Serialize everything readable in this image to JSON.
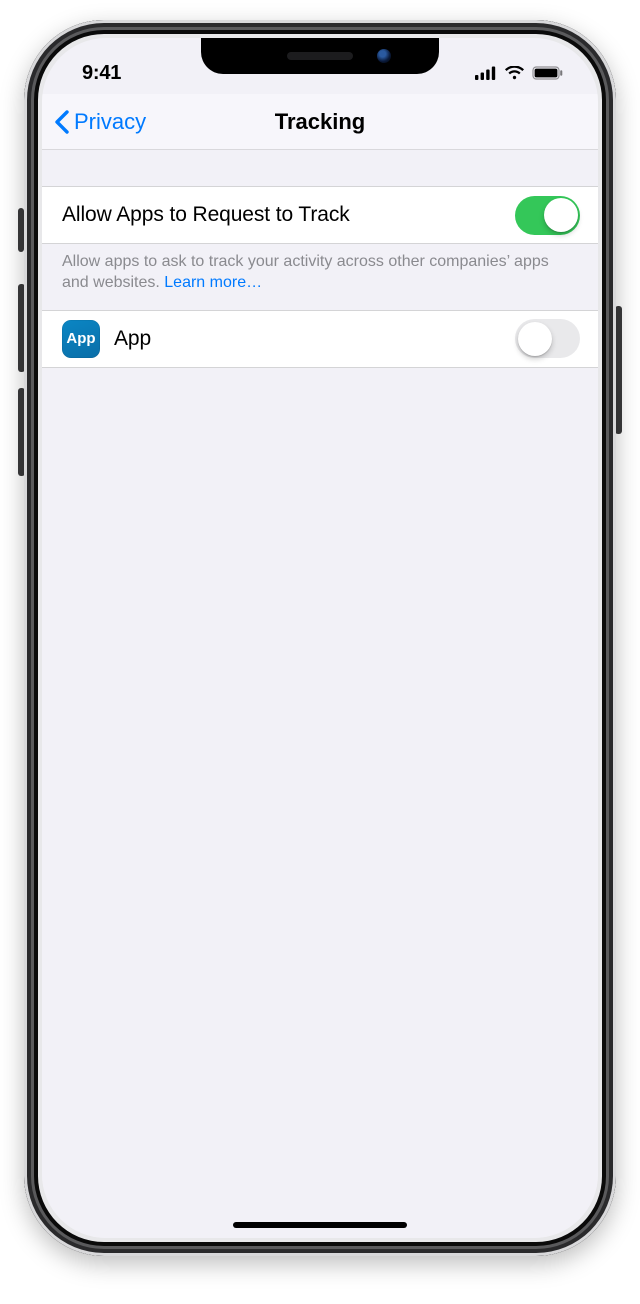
{
  "status": {
    "time": "9:41"
  },
  "nav": {
    "back_label": "Privacy",
    "title": "Tracking"
  },
  "allow": {
    "label": "Allow Apps to Request to Track",
    "on": true
  },
  "footer": {
    "text": "Allow apps to ask to track your activity across other companies’ apps and websites. ",
    "link": "Learn more…"
  },
  "apps": [
    {
      "icon_label": "App",
      "name": "App",
      "on": false
    }
  ]
}
